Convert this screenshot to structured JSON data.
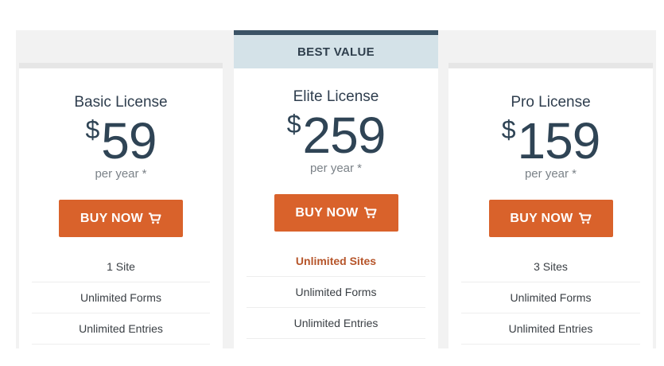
{
  "badge": "BEST VALUE",
  "colors": {
    "accent": "#d9622b",
    "highlight_text": "#b6552a",
    "badge_bg": "#d4e2e8",
    "badge_bar": "#3b5366"
  },
  "plans": {
    "basic": {
      "title": "Basic License",
      "currency": "$",
      "price": "59",
      "period": "per year *",
      "button": "BUY NOW",
      "features": [
        "1 Site",
        "Unlimited Forms",
        "Unlimited Entries"
      ]
    },
    "elite": {
      "title": "Elite License",
      "currency": "$",
      "price": "259",
      "period": "per year *",
      "button": "BUY NOW",
      "features": [
        "Unlimited Sites",
        "Unlimited Forms",
        "Unlimited Entries"
      ]
    },
    "pro": {
      "title": "Pro License",
      "currency": "$",
      "price": "159",
      "period": "per year *",
      "button": "BUY NOW",
      "features": [
        "3 Sites",
        "Unlimited Forms",
        "Unlimited Entries"
      ]
    }
  },
  "icons": {
    "button_icon": "cart-icon"
  }
}
